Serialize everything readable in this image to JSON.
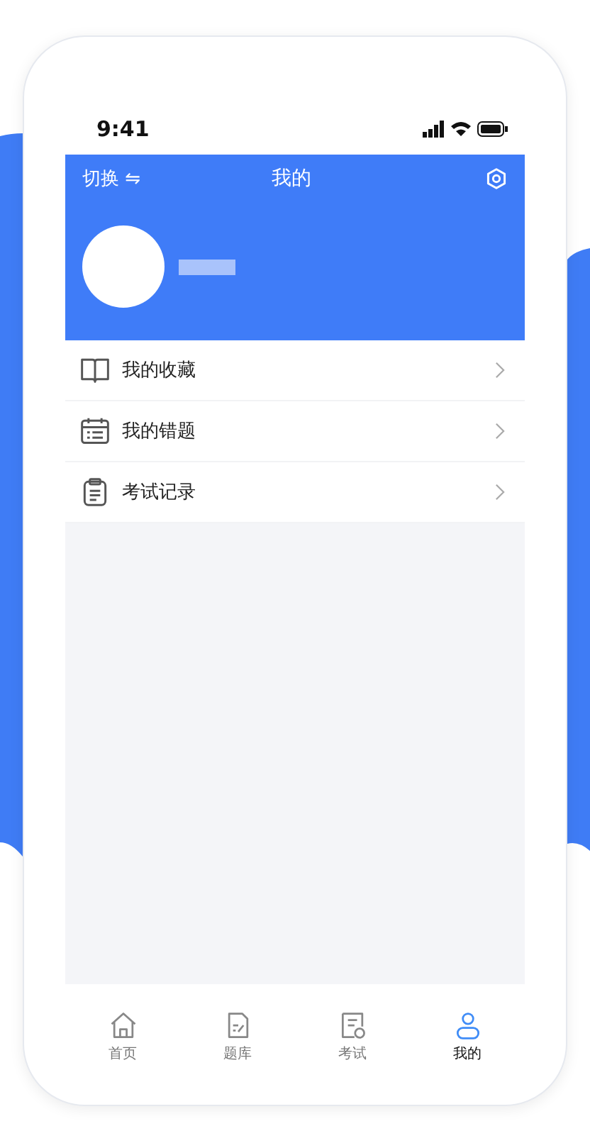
{
  "status_bar": {
    "time": "9:41"
  },
  "header": {
    "switch_label": "切换 ⇋",
    "title": "我的"
  },
  "menu": [
    {
      "kind": "book",
      "label": "我的收藏"
    },
    {
      "kind": "calendar",
      "label": "我的错题"
    },
    {
      "kind": "clipboard",
      "label": "考试记录"
    }
  ],
  "tab_bar": [
    {
      "kind": "home",
      "label": "首页",
      "selected": false
    },
    {
      "kind": "bank",
      "label": "题库",
      "selected": false
    },
    {
      "kind": "exam",
      "label": "考试",
      "selected": false
    },
    {
      "kind": "me",
      "label": "我的",
      "selected": true
    }
  ]
}
